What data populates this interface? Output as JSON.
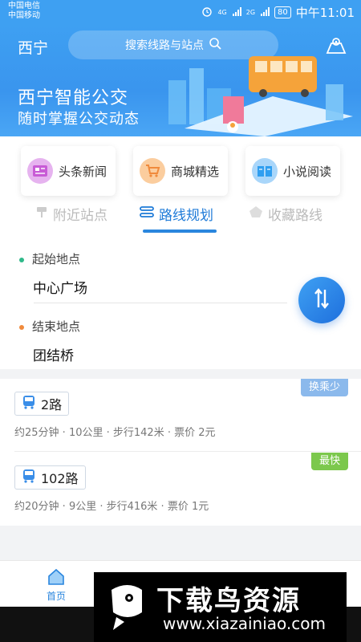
{
  "status": {
    "carrier1": "中国电信",
    "carrier2": "中国移动",
    "signal_labels": [
      "4G",
      "2G"
    ],
    "battery": "80",
    "time": "中午11:01"
  },
  "header": {
    "city": "西宁",
    "search_placeholder": "搜索线路与站点",
    "banner_title": "西宁智能公交",
    "banner_subtitle": "随时掌握公交动态"
  },
  "tiles": [
    {
      "label": "头条新闻",
      "icon": "news-icon",
      "color": "#c85bd6"
    },
    {
      "label": "商城精选",
      "icon": "cart-icon",
      "color": "#f08a3c"
    },
    {
      "label": "小说阅读",
      "icon": "book-icon",
      "color": "#2f9ef0"
    }
  ],
  "tabs": [
    {
      "label": "附近站点",
      "active": false
    },
    {
      "label": "路线规划",
      "active": true
    },
    {
      "label": "收藏路线",
      "active": false
    }
  ],
  "planner": {
    "start_label": "起始地点",
    "start_value": "中心广场",
    "end_label": "结束地点",
    "end_value": "团结桥"
  },
  "routes": [
    {
      "name": "2路",
      "tag": "换乘少",
      "tag_color": "#8bb9ec",
      "info": "约25分钟 · 10公里 · 步行142米 · 票价  2元"
    },
    {
      "name": "102路",
      "tag": "最快",
      "tag_color": "#7cc84d",
      "info": "约20分钟 · 9公里 · 步行416米 · 票价  1元"
    }
  ],
  "nav": {
    "home_label": "首页"
  },
  "watermark": {
    "title": "下载鸟资源",
    "url": "www.xiazainiao.com"
  }
}
